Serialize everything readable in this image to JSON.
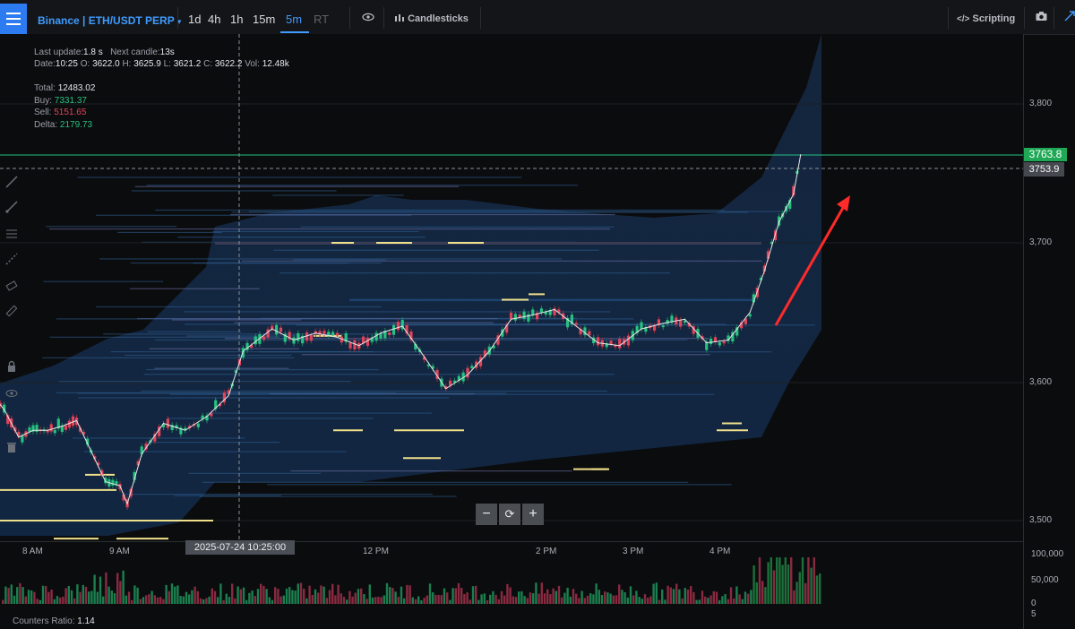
{
  "header": {
    "symbol": "Binance | ETH/USDT PERP",
    "symbol_caret": "▾",
    "timeframes": [
      {
        "label": "1d",
        "state": "normal"
      },
      {
        "label": "4h",
        "state": "normal"
      },
      {
        "label": "1h",
        "state": "normal"
      },
      {
        "label": "15m",
        "state": "normal"
      },
      {
        "label": "5m",
        "state": "active"
      },
      {
        "label": "RT",
        "state": "disabled"
      }
    ],
    "eye_icon": "eye-icon",
    "chart_type_label": "Candlesticks",
    "scripting_label": "Scripting",
    "camera_icon": "camera-icon"
  },
  "info": {
    "last_update_label": "Last update:",
    "last_update_value": "1.8 s",
    "next_candle_label": "Next candle:",
    "next_candle_value": "13s",
    "date_label": "Date:",
    "date_value": "10:25",
    "o_label": "O:",
    "o_value": "3622.0",
    "h_label": "H:",
    "h_value": "3625.9",
    "l_label": "L:",
    "l_value": "3621.2",
    "c_label": "C:",
    "c_value": "3622.2",
    "vol_label": "Vol:",
    "vol_value": "12.48k"
  },
  "totals": {
    "total_label": "Total:",
    "total_value": "12483.02",
    "buy_label": "Buy:",
    "buy_value": "7331.37",
    "sell_label": "Sell:",
    "sell_value": "5151.65",
    "delta_label": "Delta:",
    "delta_value": "2179.73"
  },
  "colors": {
    "accent": "#3f9bff",
    "buy": "#26c281",
    "sell": "#e0445b",
    "heatmap": "#1e3b63",
    "liquidity_line": "#f0e08a",
    "annotation_arrow": "#ff2a2a",
    "last_price_bg": "#1fa855"
  },
  "price_axis": {
    "ticks": [
      "3,800",
      "3,700",
      "3,600",
      "3,500"
    ],
    "last_price": "3763.8",
    "crosshair_price": "3753.9"
  },
  "time_axis": {
    "ticks": [
      "8 AM",
      "9 AM",
      "12 PM",
      "2 PM",
      "3 PM",
      "4 PM"
    ],
    "crosshair_time": "2025-07-24 10:25:00"
  },
  "volume_axis": {
    "ticks": [
      "100,000",
      "50,000",
      "0",
      "5"
    ]
  },
  "zoom": {
    "minus": "−",
    "reset": "⟳",
    "plus": "+"
  },
  "footer": {
    "counters_ratio_label": "Counters Ratio:",
    "counters_ratio_value": "1.14"
  },
  "left_tools": [
    "line-tool-icon",
    "ray-tool-icon",
    "fib-tool-icon",
    "measure-tool-icon",
    "brush-tool-icon",
    "ruler-icon",
    "lock-icon",
    "eye-icon",
    "trash-icon"
  ],
  "chart_data": {
    "type": "candlestick",
    "instrument": "ETH/USDT PERP",
    "timeframe": "5m",
    "ylim": [
      3480,
      3840
    ],
    "price_path": [
      {
        "t": "7:30",
        "p": 3592
      },
      {
        "t": "7:40",
        "p": 3580
      },
      {
        "t": "7:50",
        "p": 3560
      },
      {
        "t": "8:00",
        "p": 3565
      },
      {
        "t": "8:10",
        "p": 3565
      },
      {
        "t": "8:20",
        "p": 3568
      },
      {
        "t": "8:30",
        "p": 3572
      },
      {
        "t": "8:40",
        "p": 3550
      },
      {
        "t": "8:50",
        "p": 3528
      },
      {
        "t": "9:00",
        "p": 3525
      },
      {
        "t": "9:05",
        "p": 3512
      },
      {
        "t": "9:15",
        "p": 3548
      },
      {
        "t": "9:30",
        "p": 3570
      },
      {
        "t": "9:45",
        "p": 3565
      },
      {
        "t": "10:00",
        "p": 3575
      },
      {
        "t": "10:15",
        "p": 3590
      },
      {
        "t": "10:25",
        "p": 3622
      },
      {
        "t": "10:45",
        "p": 3638
      },
      {
        "t": "11:00",
        "p": 3630
      },
      {
        "t": "11:15",
        "p": 3635
      },
      {
        "t": "11:30",
        "p": 3632
      },
      {
        "t": "11:45",
        "p": 3626
      },
      {
        "t": "12:00",
        "p": 3635
      },
      {
        "t": "12:15",
        "p": 3640
      },
      {
        "t": "12:30",
        "p": 3618
      },
      {
        "t": "12:45",
        "p": 3595
      },
      {
        "t": "13:00",
        "p": 3605
      },
      {
        "t": "13:15",
        "p": 3622
      },
      {
        "t": "13:30",
        "p": 3645
      },
      {
        "t": "13:45",
        "p": 3648
      },
      {
        "t": "14:00",
        "p": 3652
      },
      {
        "t": "14:15",
        "p": 3640
      },
      {
        "t": "14:30",
        "p": 3628
      },
      {
        "t": "14:45",
        "p": 3626
      },
      {
        "t": "15:00",
        "p": 3638
      },
      {
        "t": "15:15",
        "p": 3642
      },
      {
        "t": "15:30",
        "p": 3645
      },
      {
        "t": "15:45",
        "p": 3628
      },
      {
        "t": "16:00",
        "p": 3630
      },
      {
        "t": "16:15",
        "p": 3650
      },
      {
        "t": "16:25",
        "p": 3680
      },
      {
        "t": "16:35",
        "p": 3715
      },
      {
        "t": "16:45",
        "p": 3735
      },
      {
        "t": "16:50",
        "p": 3763.8
      }
    ],
    "liquidity_levels": [
      3700,
      3659,
      3633,
      3565,
      3545,
      3537,
      3513,
      3500
    ],
    "volume_scale": [
      0,
      50000,
      100000
    ]
  }
}
